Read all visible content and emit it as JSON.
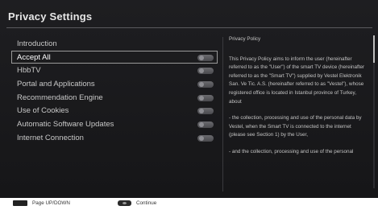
{
  "window": {
    "title": "Privacy Settings"
  },
  "menu": {
    "items": [
      {
        "label": "Introduction",
        "toggle": false,
        "selected": false
      },
      {
        "label": "Accept All",
        "toggle": true,
        "selected": true
      },
      {
        "label": "HbbTV",
        "toggle": true,
        "selected": false
      },
      {
        "label": "Portal and Applications",
        "toggle": true,
        "selected": false
      },
      {
        "label": "Recommendation Engine",
        "toggle": true,
        "selected": false
      },
      {
        "label": "Use of Cookies",
        "toggle": true,
        "selected": false
      },
      {
        "label": "Automatic Software Updates",
        "toggle": true,
        "selected": false
      },
      {
        "label": "Internet Connection",
        "toggle": true,
        "selected": false
      }
    ]
  },
  "policy": {
    "title": "Privacy Policy",
    "paragraphs": [
      "This Privacy Policy aims to inform the user (hereinafter referred to as the \"User\") of the smart TV device (hereinafter referred to as the \"Smart TV\") supplied by Vestel Elektronik San. Ve Tic. A.S. (hereinafter referred to as \"Vestel\"), whose registered office is located in Istanbul province of Turkey, about",
      "- the collection, processing and use of the personal data by Vestel, when the Smart TV is connected to the internet (please see Section 1) by the User,",
      "- and the collection, processing and use of the personal"
    ]
  },
  "footer": {
    "page_hint": "Page UP/DOWN",
    "continue_hint": "Continue"
  },
  "colors": {
    "background": "#1b1b1e",
    "text": "#c8c8c8",
    "selection_border": "#9a9a9a"
  }
}
